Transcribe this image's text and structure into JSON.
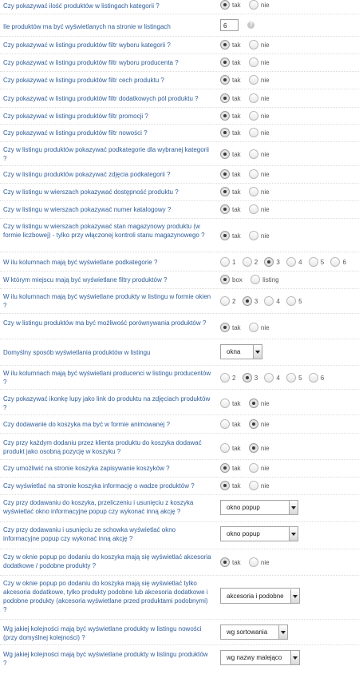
{
  "common": {
    "yes": "tak",
    "no": "nie",
    "help_icon": "?"
  },
  "rows": [
    {
      "label": "Czy pokazywać ilość produktów w listingach kategorii ?",
      "selected": "tak"
    },
    {
      "label": "Ile produktów ma być wyświetlanych na stronie w listingach",
      "value": "6"
    },
    {
      "label": "Czy pokazywać w listingu produktów filtr wyboru kategorii ?",
      "selected": "tak"
    },
    {
      "label": "Czy pokazywać w listingu produktów filtr wyboru producenta ?",
      "selected": "tak"
    },
    {
      "label": "Czy pokazywać w listingu produktów filtr cech produktu ?",
      "selected": "tak"
    },
    {
      "label": "Czy pokazywać w listingu produktów filtr dodatkowych pól produktu ?",
      "selected": "tak"
    },
    {
      "label": "Czy pokazywać w listingu produktów filtr promocji ?",
      "selected": "tak"
    },
    {
      "label": "Czy pokazywać w listingu produktów filtr nowości ?",
      "selected": "tak"
    },
    {
      "label": "Czy w listingu produktów pokazywać podkategorie dla wybranej kategorii ?",
      "selected": "tak"
    },
    {
      "label": "Czy w listingu produktów pokazywać zdjęcia podkategorii ?",
      "selected": "tak"
    },
    {
      "label": "Czy w listingu w wierszach pokazywać dostępność produktu ?",
      "selected": "tak"
    },
    {
      "label": "Czy w listingu w wierszach pokazywać numer katalogowy ?",
      "selected": "tak"
    },
    {
      "label": "Czy w listingu w wierszach pokazywać stan magazynowy produktu (w formie liczbowej) - tylko przy włączonej kontroli stanu magazynowego ?",
      "selected": "tak"
    },
    {
      "label": "W ilu kolumnach mają być wyświetlane podkategorie ?",
      "options": [
        "1",
        "2",
        "3",
        "4",
        "5",
        "6"
      ],
      "selected": "3"
    },
    {
      "label": "W którym miejscu mają być wyświetlane filtry produktów ?",
      "options": [
        "box",
        "listing"
      ],
      "selected": "box"
    },
    {
      "label": "W ilu kolumnach mają być wyświetlane produkty w listingu w formie okien ?",
      "options": [
        "2",
        "3",
        "4",
        "5"
      ],
      "selected": "3"
    },
    {
      "label": "Czy w listingu produktów ma być możliwość porównywania produktów ?",
      "selected": "tak"
    },
    {
      "label": "Domyślny sposób wyświetlania produktów w listingu",
      "value": "okna"
    },
    {
      "label": "W ilu kolumnach mają być wyświetlani producenci w listingu producentów ?",
      "options": [
        "2",
        "3",
        "4",
        "5",
        "6"
      ],
      "selected": "3"
    },
    {
      "label": "Czy pokazywać ikonkę lupy jako link do produktu na zdjęciach produktów ?",
      "selected": "nie"
    },
    {
      "label": "Czy dodawanie do koszyka ma być w formie animowanej ?",
      "selected": "nie"
    },
    {
      "label": "Czy przy każdym dodaniu przez klienta produktu do koszyka dodawać produkt jako osobną pozycję w koszyku ?",
      "selected": "nie"
    },
    {
      "label": "Czy umożliwić na stronie koszyka zapisywanie koszyków ?",
      "selected": "tak"
    },
    {
      "label": "Czy wyświetlać na stronie koszyka informację o wadze produktów ?",
      "selected": "tak"
    },
    {
      "label": "Czy przy dodawaniu do koszyka, przeliczeniu i usunięciu z koszyka wyświetlać okno informacyjne popup czy wykonać inną akcję ?",
      "value": "okno popup"
    },
    {
      "label": "Czy przy dodawaniu i usunięciu ze schowka wyświetlać okno informacyjne popup czy wykonać inną akcję ?",
      "value": "okno popup"
    },
    {
      "label": "Czy w oknie popup po dodaniu do koszyka mają się wyświetlać akcesoria dodatkowe / podobne produkty ?",
      "selected": "tak"
    },
    {
      "label": "Czy w oknie popup po dodaniu do koszyka mają się wyświetlać tylko akcesoria dodatkowe, tylko produkty podobne lub akcesoria dodatkowe i podobne produkty (akcesoria wyświetlane przed produktami podobnymi) ?",
      "value": "akcesoria i podobne"
    },
    {
      "label": "Wg jakiej kolejności mają być wyświetlane produkty w listingu nowości (przy domyślnej kolejności) ?",
      "value": "wg sortowania"
    },
    {
      "label": "Wg jakiej kolejności mają być wyświetlane produkty w listingu produktów ?",
      "value": "wg nazwy malejąco"
    }
  ]
}
